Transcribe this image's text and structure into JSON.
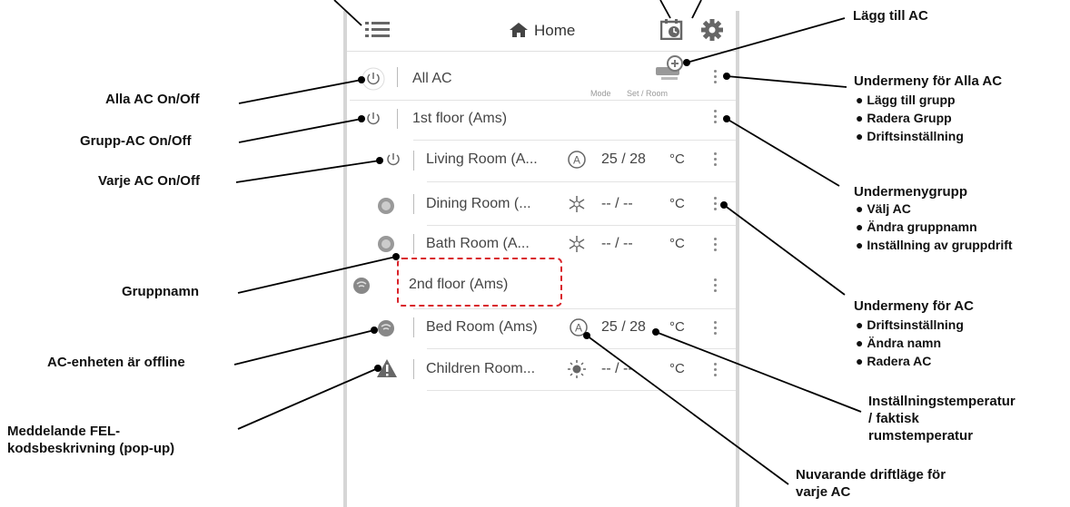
{
  "header": {
    "title": "Home",
    "menu_icon": "list-icon",
    "home_icon": "house-icon",
    "schedule_icon": "calendar-clock-icon",
    "settings_icon": "gear-icon"
  },
  "rows": [
    {
      "name": "All AC",
      "status_icon": "power-icon"
    },
    {
      "name": "1st floor (Ams)",
      "status_icon": "power-icon"
    },
    {
      "name": "Living Room (A...",
      "mode_icon": "auto-mode-icon",
      "temps": "25 / 28",
      "unit": "°C",
      "status_icon": "power-icon"
    },
    {
      "name": "Dining Room (...",
      "mode_icon": "cool-mode-icon",
      "temps": "-- / --",
      "unit": "°C",
      "status_icon": "power-on-icon"
    },
    {
      "name": "Bath Room (A...",
      "mode_icon": "cool-mode-icon",
      "temps": "-- / --",
      "unit": "°C",
      "status_icon": "power-on-icon"
    },
    {
      "name": "2nd floor (Ams)",
      "status_icon": "offline-icon"
    },
    {
      "name": "Bed Room (Ams)",
      "mode_icon": "auto-mode-icon",
      "temps": "25 / 28",
      "unit": "°C",
      "status_icon": "offline-icon"
    },
    {
      "name": "Children Room...",
      "mode_icon": "heat-mode-icon",
      "temps": "-- / --",
      "unit": "°C",
      "status_icon": "warning-icon"
    }
  ],
  "all_ac_sub": {
    "mode": "Mode",
    "set_room": "Set / Room"
  },
  "annotations": {
    "add_ac": "Lägg till AC",
    "all_onoff": "Alla AC On/Off",
    "group_onoff": "Grupp-AC On/Off",
    "each_onoff": "Varje AC On/Off",
    "group_name": "Gruppnamn",
    "offline": "AC-enheten är offline",
    "error_line1": "Meddelande FEL-",
    "error_line2": "kodsbeskrivning (pop-up)",
    "submenu_all_title": "Undermeny för Alla AC",
    "submenu_all_items": [
      "● Lägg till grupp",
      "● Radera Grupp",
      "● Driftsinställning"
    ],
    "submenu_group_title": "Undermenygrupp",
    "submenu_group_items": [
      "● Välj AC",
      "● Ändra gruppnamn",
      "● Inställning av gruppdrift"
    ],
    "submenu_ac_title": "Undermeny för AC",
    "submenu_ac_items": [
      "● Driftsinställning",
      "● Ändra namn",
      "● Radera AC"
    ],
    "temp_line1": "Inställningstemperatur",
    "temp_line2": "/ faktisk",
    "temp_line3": "rumstemperatur",
    "mode_line1": "Nuvarande driftläge för",
    "mode_line2": "varje AC"
  },
  "colors": {
    "dash": "#d9232a",
    "icon": "#777777",
    "line": "#000000"
  }
}
